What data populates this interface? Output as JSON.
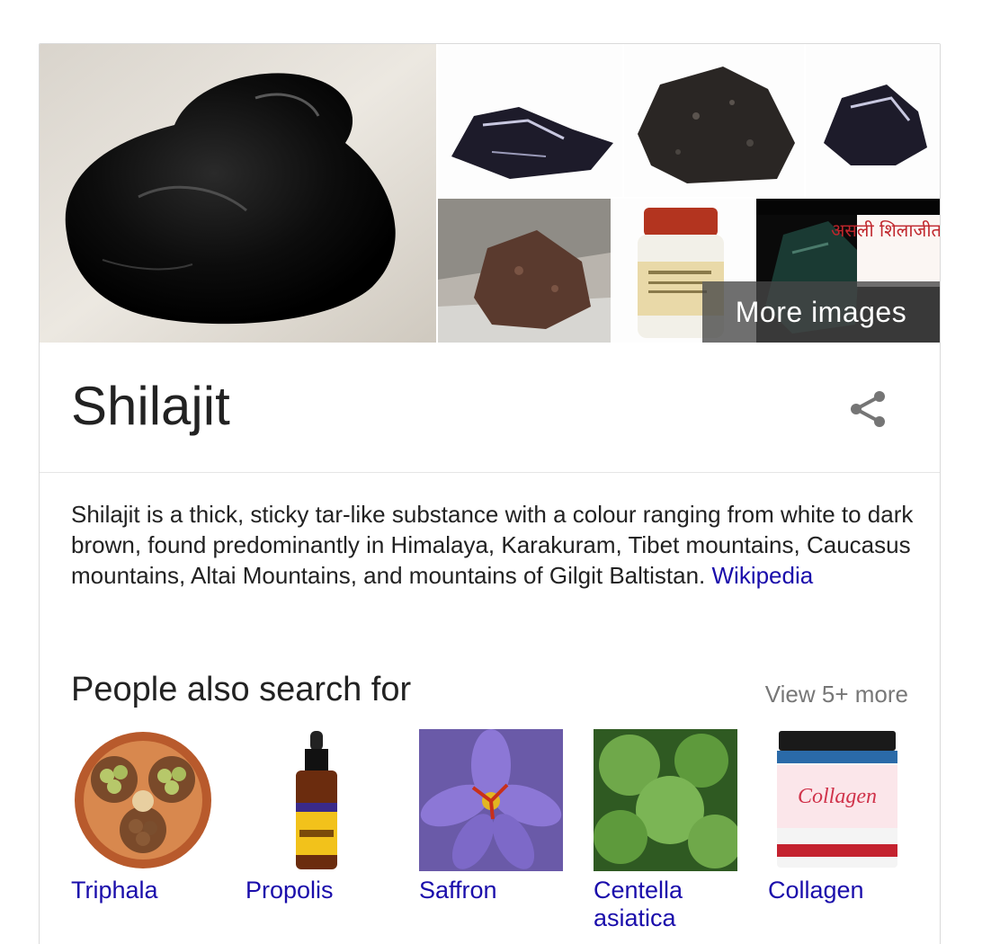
{
  "knowledge_panel": {
    "more_images_label": "More images",
    "image_overlay_text": "असली शिलाजीत की",
    "title": "Shilajit",
    "description": "Shilajit is a thick, sticky tar-like substance with a colour ranging from white to dark brown, found predominantly in Himalaya, Karakuram, Tibet mountains, Caucasus mountains, Altai Mountains, and mountains of Gilgit Baltistan. ",
    "source_link": "Wikipedia",
    "share_icon": "share-icon",
    "people_also_search": {
      "heading": "People also search for",
      "view_more": "View 5+ more",
      "items": [
        {
          "label": "Triphala"
        },
        {
          "label": "Propolis"
        },
        {
          "label": "Saffron"
        },
        {
          "label": "Centella asiatica"
        },
        {
          "label": "Collagen"
        }
      ]
    }
  },
  "colors": {
    "link": "#1a0dab",
    "text": "#222222",
    "muted": "#777777",
    "border": "#dadada"
  }
}
